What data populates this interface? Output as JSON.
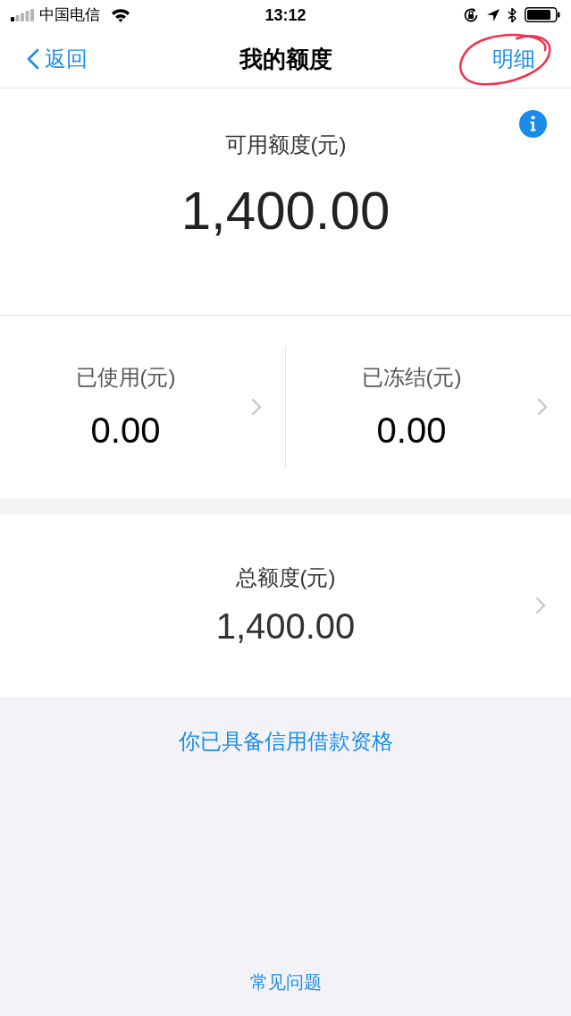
{
  "status_bar": {
    "carrier": "中国电信",
    "time": "13:12"
  },
  "nav_bar": {
    "back_label": "返回",
    "title": "我的额度",
    "action": "明细"
  },
  "available": {
    "label": "可用额度(元)",
    "amount": "1,400.00"
  },
  "breakdown": [
    {
      "label": "已使用(元)",
      "amount": "0.00"
    },
    {
      "label": "已冻结(元)",
      "amount": "0.00"
    }
  ],
  "total": {
    "label": "总额度(元)",
    "amount": "1,400.00"
  },
  "eligibility_link": "你已具备信用借款资格",
  "footer_link": "常见问题"
}
